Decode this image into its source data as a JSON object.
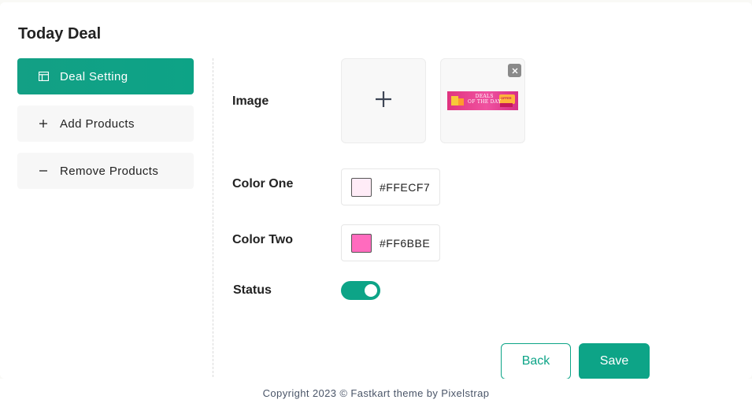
{
  "page": {
    "title": "Today Deal"
  },
  "sidebar": {
    "items": [
      {
        "label": "Deal Setting",
        "icon": "table-icon",
        "active": true
      },
      {
        "label": "Add Products",
        "icon": "plus-icon",
        "active": false
      },
      {
        "label": "Remove Products",
        "icon": "minus-icon",
        "active": false
      }
    ]
  },
  "form": {
    "image_label": "Image",
    "banner_text_line1": "DEALS",
    "banner_text_line2": "OF THE DAY",
    "banner_tag": "OFFER",
    "color_one_label": "Color One",
    "color_one_value": "#FFECF7",
    "color_two_label": "Color Two",
    "color_two_value": "#FF6BBE",
    "status_label": "Status",
    "status_on": true,
    "back_label": "Back",
    "save_label": "Save"
  },
  "colors": {
    "accent": "#0da487"
  },
  "footer": {
    "text": "Copyright 2023 © Fastkart theme by Pixelstrap"
  }
}
